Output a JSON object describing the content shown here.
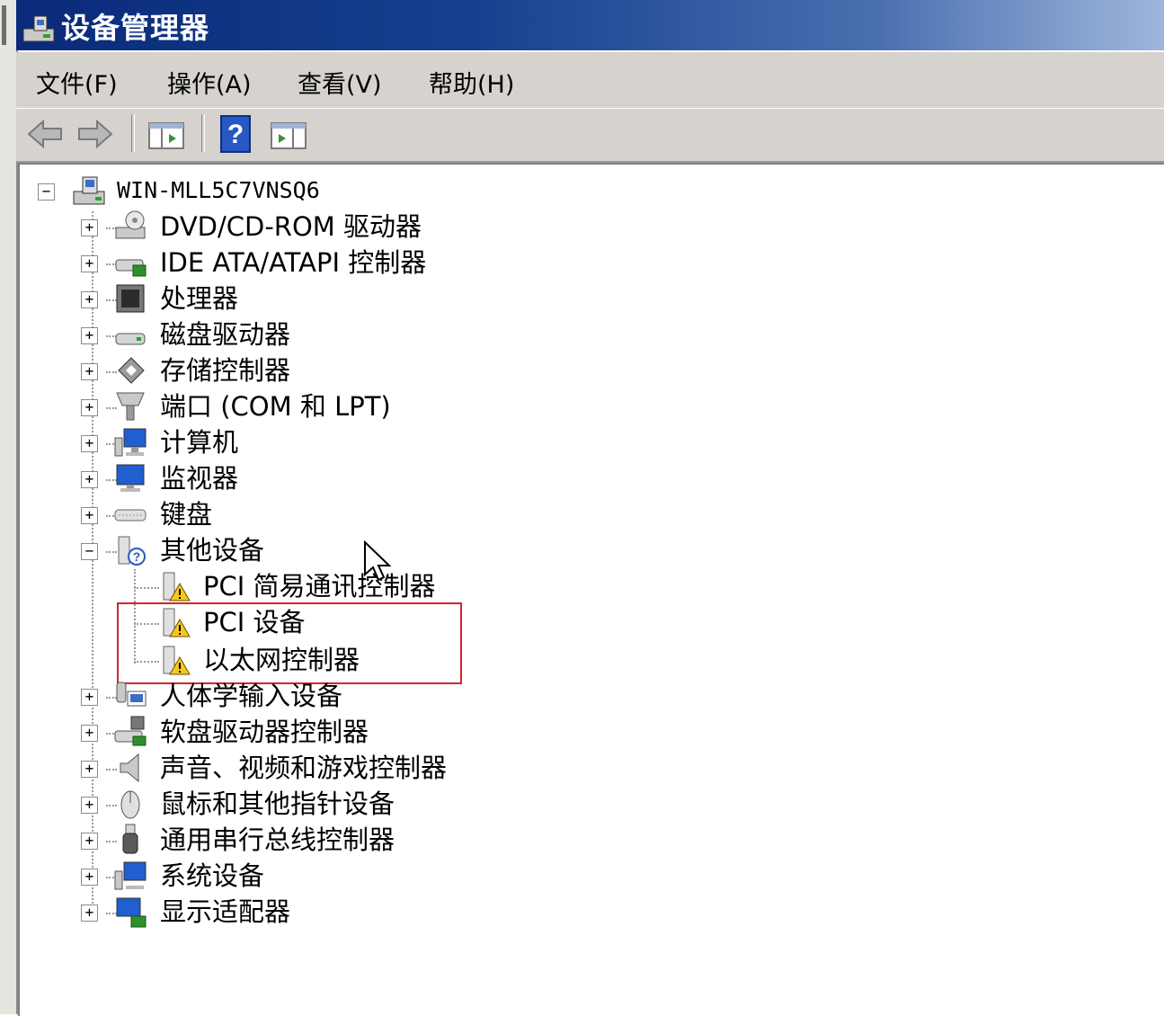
{
  "window": {
    "title": "设备管理器"
  },
  "menu": [
    "文件(F)",
    "操作(A)",
    "查看(V)",
    "帮助(H)"
  ],
  "toolbar": {
    "buttons": [
      {
        "name": "back-button",
        "icon": "back-arrow-icon"
      },
      {
        "name": "forward-button",
        "icon": "forward-arrow-icon"
      },
      {
        "name": "show-hide-console-tree-button",
        "icon": "console-tree-icon"
      },
      {
        "name": "help-button",
        "icon": "help-icon",
        "glyph": "?"
      },
      {
        "name": "show-hide-action-pane-button",
        "icon": "action-pane-icon"
      }
    ]
  },
  "tree": {
    "root": {
      "label": "WIN-MLL5C7VNSQ6",
      "icon": "computer-icon",
      "expanded": true
    },
    "categories": [
      {
        "label": "DVD/CD-ROM 驱动器",
        "icon": "dvd-drive-icon",
        "expanded": false
      },
      {
        "label": "IDE ATA/ATAPI 控制器",
        "icon": "ide-controller-icon",
        "expanded": false
      },
      {
        "label": "处理器",
        "icon": "processor-icon",
        "expanded": false
      },
      {
        "label": "磁盘驱动器",
        "icon": "disk-drive-icon",
        "expanded": false
      },
      {
        "label": "存储控制器",
        "icon": "storage-controller-icon",
        "expanded": false
      },
      {
        "label": "端口 (COM 和 LPT)",
        "icon": "port-icon",
        "expanded": false
      },
      {
        "label": "计算机",
        "icon": "computer-monitor-icon",
        "expanded": false
      },
      {
        "label": "监视器",
        "icon": "monitor-icon",
        "expanded": false
      },
      {
        "label": "键盘",
        "icon": "keyboard-icon",
        "expanded": false
      },
      {
        "label": "其他设备",
        "icon": "unknown-device-icon",
        "expanded": true,
        "children": [
          {
            "label": "PCI 简易通讯控制器",
            "icon": "warning-device-icon"
          },
          {
            "label": "PCI 设备",
            "icon": "warning-device-icon"
          },
          {
            "label": "以太网控制器",
            "icon": "warning-device-icon"
          }
        ]
      },
      {
        "label": "人体学输入设备",
        "icon": "hid-icon",
        "expanded": false
      },
      {
        "label": "软盘驱动器控制器",
        "icon": "floppy-controller-icon",
        "expanded": false
      },
      {
        "label": "声音、视频和游戏控制器",
        "icon": "sound-icon",
        "expanded": false
      },
      {
        "label": "鼠标和其他指针设备",
        "icon": "mouse-icon",
        "expanded": false
      },
      {
        "label": "通用串行总线控制器",
        "icon": "usb-icon",
        "expanded": false
      },
      {
        "label": "系统设备",
        "icon": "system-device-icon",
        "expanded": false
      },
      {
        "label": "显示适配器",
        "icon": "display-adapter-icon",
        "expanded": false
      }
    ]
  },
  "expander": {
    "collapsed": "+",
    "expanded": "−"
  },
  "colors": {
    "highlight_box": "#d6242c",
    "title_bar": "#0a2a7a",
    "warning": "#f4c81e"
  }
}
